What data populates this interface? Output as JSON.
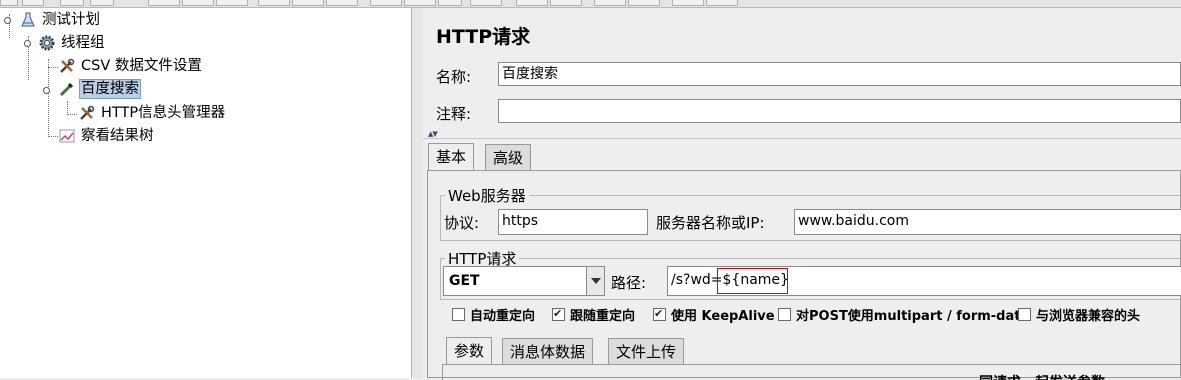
{
  "tree": {
    "items": [
      {
        "label": "测试计划",
        "icon": "flask-icon"
      },
      {
        "label": "线程组",
        "icon": "gear-icon"
      },
      {
        "label": "CSV 数据文件设置",
        "icon": "wrench-icon"
      },
      {
        "label": "百度搜索",
        "icon": "pipette-icon"
      },
      {
        "label": "HTTP信息头管理器",
        "icon": "wrench-icon"
      },
      {
        "label": "察看结果树",
        "icon": "chart-icon"
      }
    ]
  },
  "panel": {
    "title": "HTTP请求",
    "name_label": "名称:",
    "name_value": "百度搜索",
    "comment_label": "注释:",
    "comment_value": "",
    "tabs": [
      "基本",
      "高级"
    ],
    "web_server": {
      "group_title": "Web服务器",
      "protocol_label": "协议:",
      "protocol_value": "https",
      "server_label": "服务器名称或IP:",
      "server_value": "www.baidu.com"
    },
    "http_request": {
      "group_title": "HTTP请求",
      "method": "GET",
      "path_label": "路径:",
      "path_prefix": "/s?wd=",
      "path_variable": "${name}"
    },
    "options": [
      {
        "label": "自动重定向",
        "checked": false
      },
      {
        "label": "跟随重定向",
        "checked": true
      },
      {
        "label": "使用 KeepAlive",
        "checked": true
      },
      {
        "label": "对POST使用multipart / form-data",
        "checked": false
      },
      {
        "label": "与浏览器兼容的头",
        "checked": false
      }
    ],
    "subtabs": [
      "参数",
      "消息体数据",
      "文件上传"
    ],
    "partial_text": "同请求一起发送参数"
  },
  "colors": {
    "selection": "#b8cfe5",
    "highlight_border": "#dd0000"
  }
}
